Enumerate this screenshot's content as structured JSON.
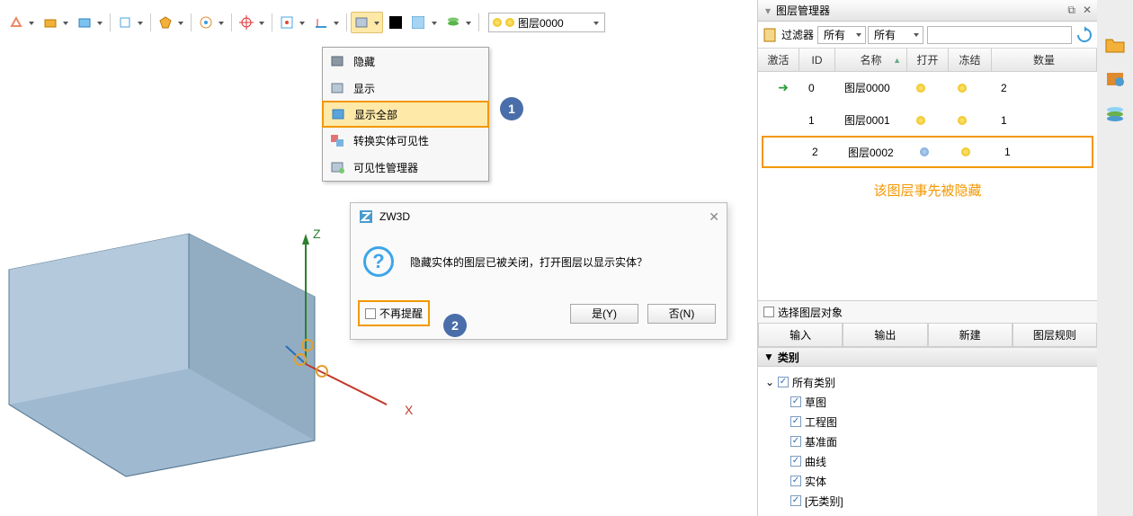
{
  "toolbar": {
    "layer_name": "图层0000"
  },
  "dropdown": {
    "items": [
      "隐藏",
      "显示",
      "显示全部",
      "转换实体可见性",
      "可见性管理器"
    ],
    "highlight_index": 2
  },
  "callouts": {
    "one": "1",
    "two": "2"
  },
  "viewport": {
    "axis_z": "Z",
    "axis_x": "X"
  },
  "dialog": {
    "title": "ZW3D",
    "message": "隐藏实体的图层已被关闭，打开图层以显示实体？",
    "dont_remind": "不再提醒",
    "yes": "是(Y)",
    "no": "否(N)"
  },
  "panel": {
    "title": "图层管理器",
    "filter_label": "过滤器",
    "filter_all1": "所有",
    "filter_all2": "所有",
    "headers": {
      "active": "激活",
      "id": "ID",
      "name": "名称",
      "open": "打开",
      "freeze": "冻结",
      "count": "数量"
    },
    "rows": [
      {
        "active": true,
        "id": "0",
        "name": "图层0000",
        "open": true,
        "count": "2"
      },
      {
        "active": false,
        "id": "1",
        "name": "图层0001",
        "open": true,
        "count": "1"
      },
      {
        "active": false,
        "id": "2",
        "name": "图层0002",
        "open": false,
        "count": "1",
        "highlight": true
      }
    ],
    "note": "该图层事先被隐藏",
    "select_label": "选择图层对象",
    "buttons": {
      "import": "输入",
      "export": "输出",
      "new": "新建",
      "rules": "图层规则"
    },
    "category_header": "类别",
    "tree": {
      "root": "所有类别",
      "items": [
        "草图",
        "工程图",
        "基准面",
        "曲线",
        "实体",
        "[无类别]"
      ]
    }
  }
}
